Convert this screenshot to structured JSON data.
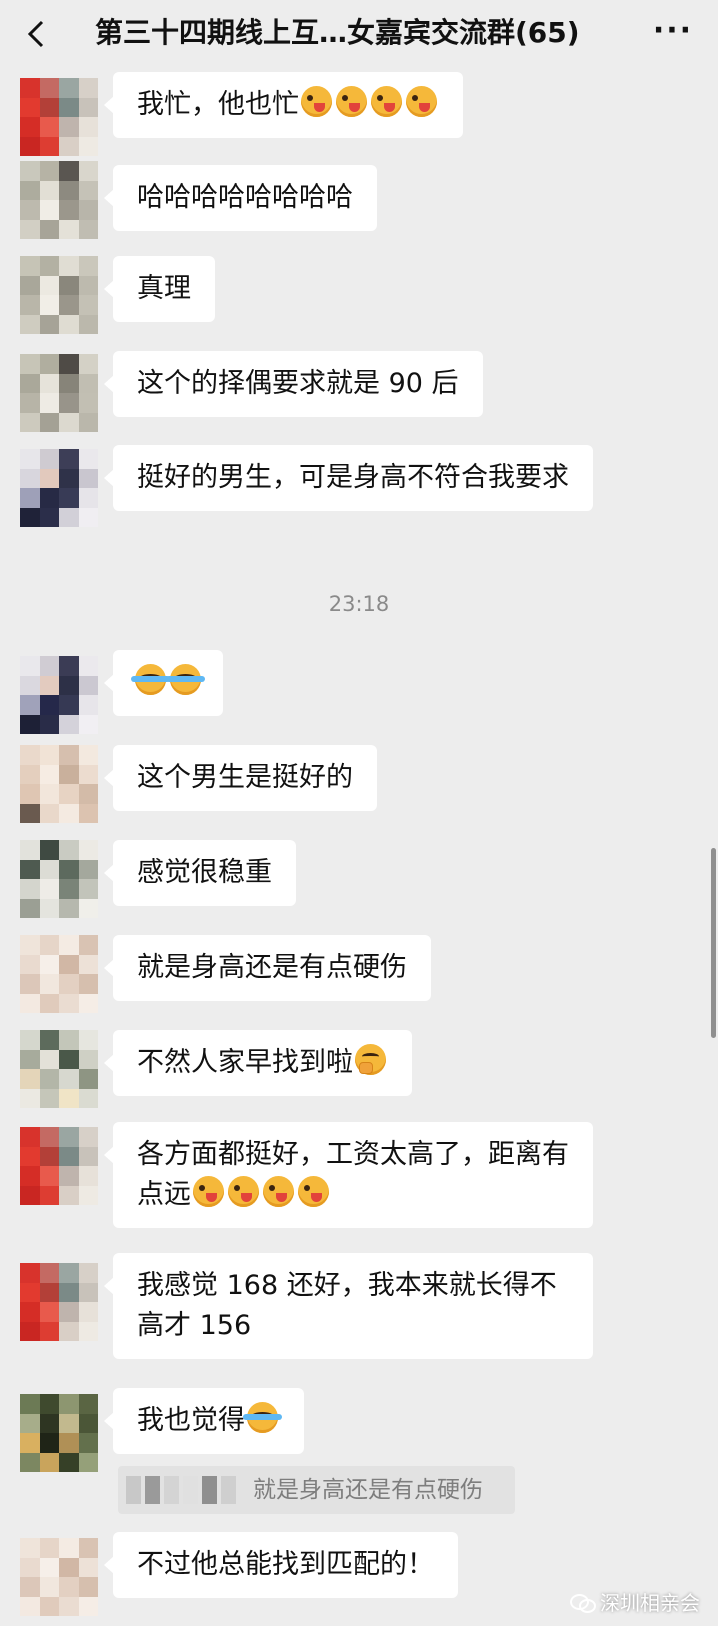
{
  "header": {
    "back_icon": "chevron-left-icon",
    "title": "第三十四期线上互…女嘉宾交流群(65)",
    "more_label": "···"
  },
  "time_separator": "23:18",
  "messages": [
    {
      "text": "我忙，他也忙",
      "emoji": [
        "wink",
        "wink",
        "wink",
        "wink"
      ]
    },
    {
      "text": "哈哈哈哈哈哈哈哈"
    },
    {
      "text": "真理"
    },
    {
      "text": "这个的择偶要求就是 90 后"
    },
    {
      "text": "挺好的男生，可是身高不符合我要求"
    },
    {
      "text": "",
      "emoji": [
        "cry",
        "cry"
      ]
    },
    {
      "text": "这个男生是挺好的"
    },
    {
      "text": "感觉很稳重"
    },
    {
      "text": "就是身高还是有点硬伤"
    },
    {
      "text": "不然人家早找到啦",
      "emoji": [
        "think"
      ]
    },
    {
      "text": "各方面都挺好，工资太高了，距离有点远",
      "emoji": [
        "wink",
        "wink",
        "wink",
        "wink"
      ]
    },
    {
      "text": "我感觉 168 还好，我本来就长得不高才 156"
    },
    {
      "text": "我也觉得",
      "emoji": [
        "cry"
      ]
    },
    {
      "text": "不过他总能找到匹配的！"
    }
  ],
  "quote": {
    "text": "就是身高还是有点硬伤"
  },
  "watermark": {
    "text": "深圳相亲会",
    "icon": "wechat-icon"
  },
  "colors": {
    "background": "#ededed",
    "bubble": "#ffffff",
    "time": "#8a8a8a"
  }
}
